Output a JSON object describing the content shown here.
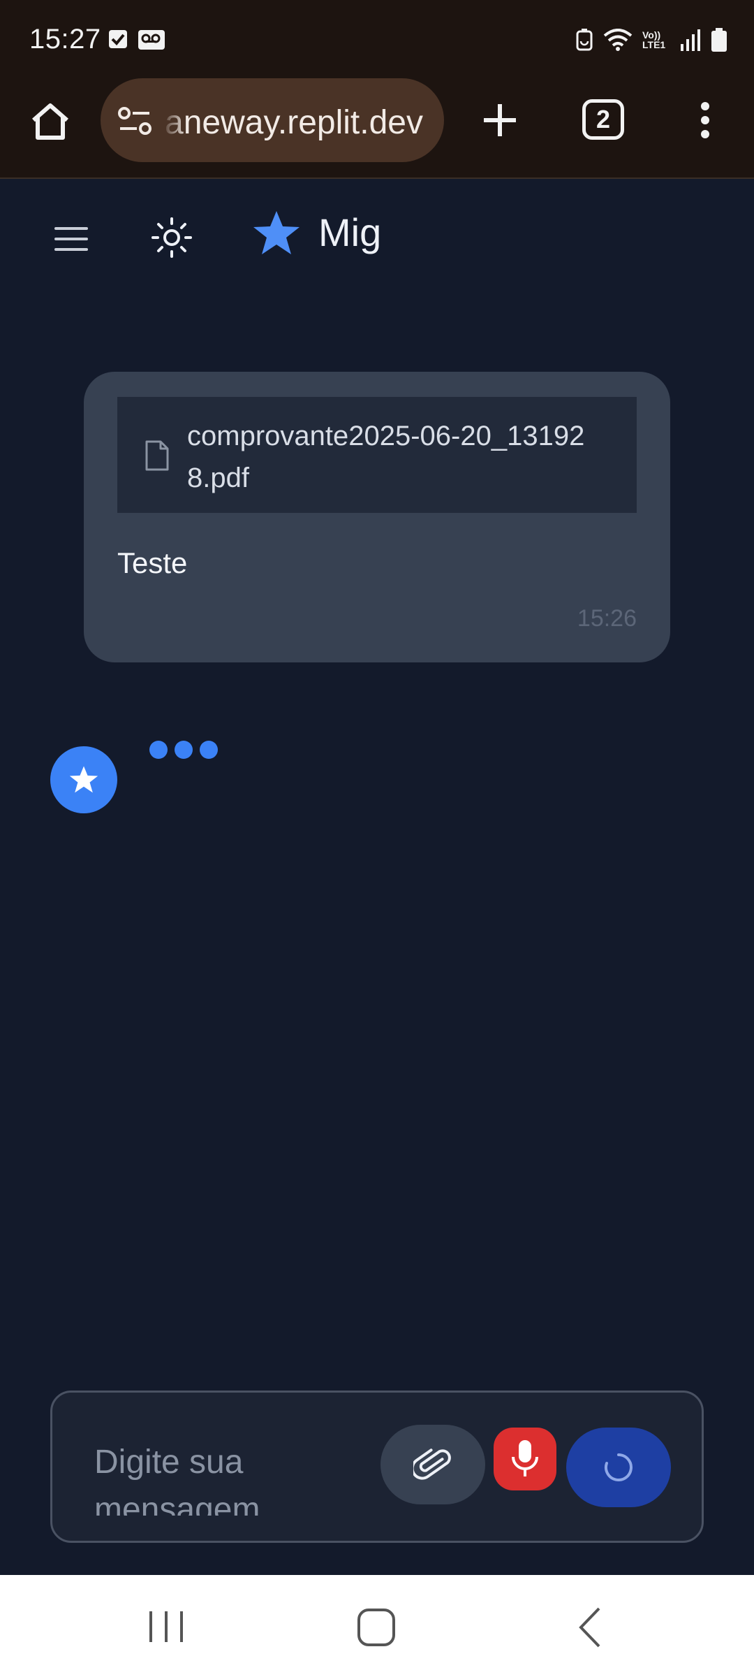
{
  "status_bar": {
    "time": "15:27",
    "left_icons": [
      "checkbox-icon",
      "voicemail-icon"
    ],
    "right_icons": [
      "battery-saver-icon",
      "wifi-icon",
      "volte-icon",
      "signal-icon",
      "battery-icon"
    ],
    "volte_label": "Vo)) LTE1"
  },
  "browser": {
    "url": "aneway.replit.dev",
    "tab_count": "2"
  },
  "app": {
    "brand_name": "Mig",
    "accent_color": "#3b82f6"
  },
  "conversation": {
    "user_message": {
      "attachment_name": "comprovante2025-06-20_131928.pdf",
      "text": "Teste",
      "time": "15:26"
    },
    "assistant": {
      "status": "typing"
    }
  },
  "composer": {
    "placeholder": "Digite sua mensagem..."
  }
}
